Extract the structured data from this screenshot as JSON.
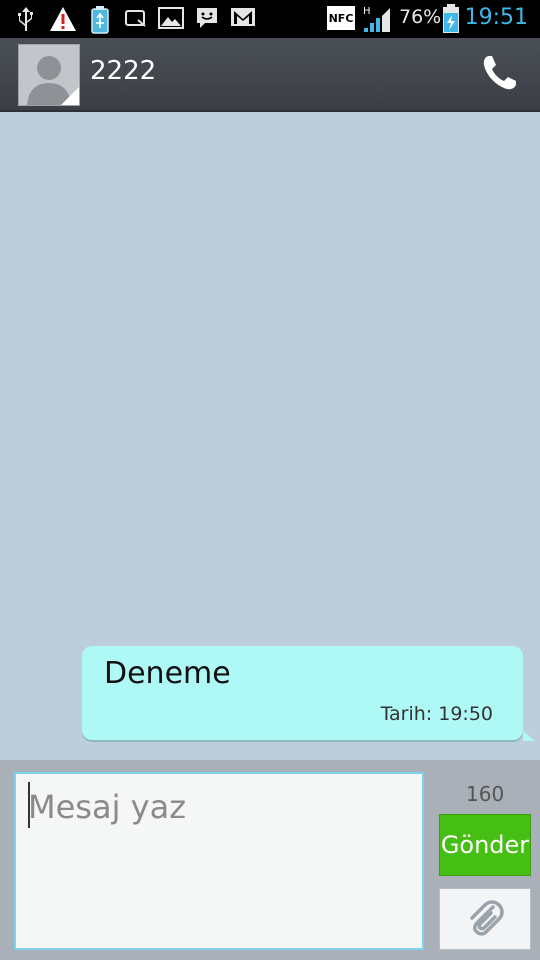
{
  "status_bar": {
    "icons_left": [
      "usb-icon",
      "warning-icon",
      "sd-card-icon",
      "drive-icon",
      "image-icon",
      "messenger-icon",
      "gmail-icon"
    ],
    "icons_right": [
      "nfc-icon",
      "signal-icon",
      "battery-icon"
    ],
    "battery": "76%",
    "time": "19:51",
    "signal_label": "H",
    "nfc_label": "NFC",
    "accent_color": "#3fb8e8"
  },
  "header": {
    "contact_name": "2222"
  },
  "conversation": {
    "messages": [
      {
        "text": "Deneme",
        "time": "Tarih: 19:50",
        "bubble_color": "#aef9f6"
      }
    ]
  },
  "compose": {
    "placeholder": "Mesaj yaz",
    "counter": "160",
    "send_label": "Gönder",
    "send_color": "#46bf14"
  }
}
